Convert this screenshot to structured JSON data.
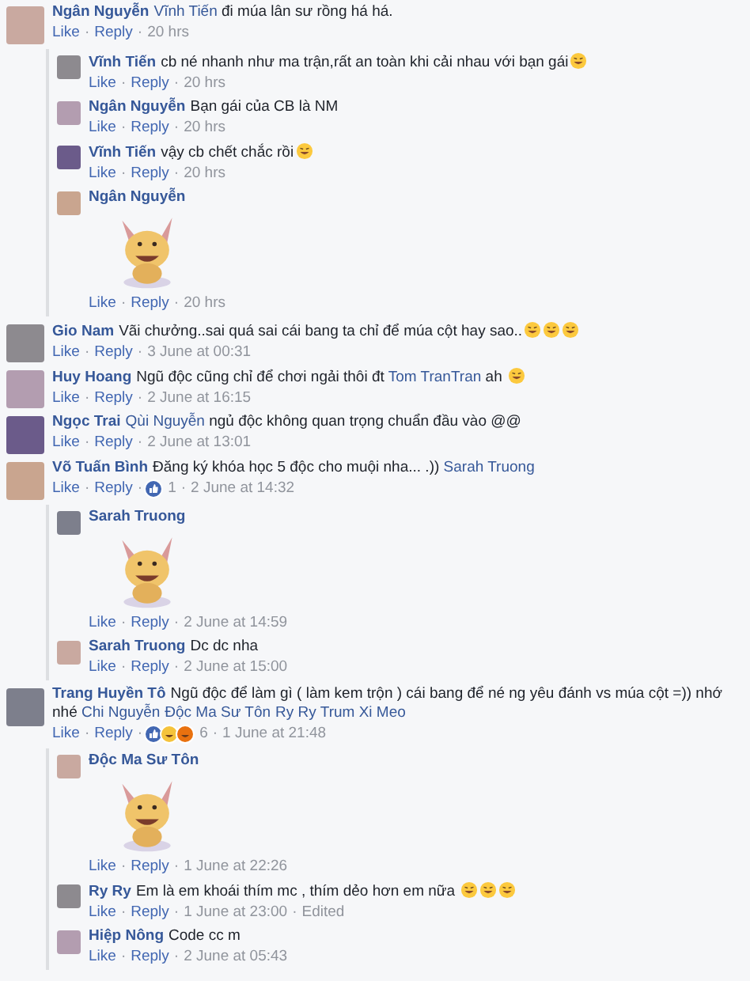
{
  "separator": "·",
  "comments": [
    {
      "author": "Ngân Nguyễn",
      "parts": [
        {
          "kind": "mention",
          "text": "Vĩnh Tiến"
        },
        {
          "kind": "text",
          "text": " đi múa lân sư rồng há há."
        }
      ],
      "like": "Like",
      "reply": "Reply",
      "time": "20 hrs",
      "replies": [
        {
          "author": "Vĩnh Tiến",
          "parts": [
            {
              "kind": "text",
              "text": "cb né nhanh như ma trận,rất an toàn khi cải nhau với bạn gái"
            },
            {
              "kind": "emoji"
            }
          ],
          "like": "Like",
          "reply": "Reply",
          "time": "20 hrs"
        },
        {
          "author": "Ngân Nguyễn",
          "parts": [
            {
              "kind": "text",
              "text": "Bạn gái của CB là NM"
            }
          ],
          "like": "Like",
          "reply": "Reply",
          "time": "20 hrs"
        },
        {
          "author": "Vĩnh Tiến",
          "parts": [
            {
              "kind": "text",
              "text": "vậy cb chết chắc rồi"
            },
            {
              "kind": "emoji"
            }
          ],
          "like": "Like",
          "reply": "Reply",
          "time": "20 hrs"
        },
        {
          "author": "Ngân Nguyễn",
          "sticker": true,
          "like": "Like",
          "reply": "Reply",
          "time": "20 hrs"
        }
      ]
    },
    {
      "author": "Gio Nam",
      "parts": [
        {
          "kind": "text",
          "text": "Vãi chưởng..sai quá sai cái bang ta chỉ để múa cột hay sao.."
        },
        {
          "kind": "emoji"
        },
        {
          "kind": "emoji"
        },
        {
          "kind": "emoji"
        }
      ],
      "like": "Like",
      "reply": "Reply",
      "time": "3 June at 00:31"
    },
    {
      "author": "Huy Hoang",
      "parts": [
        {
          "kind": "text",
          "text": "Ngũ độc cũng chỉ để chơi ngải thôi đt "
        },
        {
          "kind": "mention",
          "text": "Tom TranTran"
        },
        {
          "kind": "text",
          "text": " ah "
        },
        {
          "kind": "emoji"
        }
      ],
      "like": "Like",
      "reply": "Reply",
      "time": "2 June at 16:15"
    },
    {
      "author": "Ngọc Trai",
      "parts": [
        {
          "kind": "mention",
          "text": "Qùi Nguyễn"
        },
        {
          "kind": "text",
          "text": " ngủ độc không quan trọng chuẩn đầu vào @@"
        }
      ],
      "like": "Like",
      "reply": "Reply",
      "time": "2 June at 13:01"
    },
    {
      "author": "Võ Tuấn Bình",
      "parts": [
        {
          "kind": "text",
          "text": "Đăng ký khóa học 5 độc cho muội nha... .)) "
        },
        {
          "kind": "mention",
          "text": "Sarah Truong"
        }
      ],
      "like": "Like",
      "reply": "Reply",
      "reactions": {
        "items": [
          {
            "kind": "like"
          }
        ],
        "count": "1"
      },
      "time": "2 June at 14:32",
      "replies": [
        {
          "author": "Sarah Truong",
          "sticker": true,
          "like": "Like",
          "reply": "Reply",
          "time": "2 June at 14:59"
        },
        {
          "author": "Sarah Truong",
          "parts": [
            {
              "kind": "text",
              "text": "Dc dc nha"
            }
          ],
          "like": "Like",
          "reply": "Reply",
          "time": "2 June at 15:00"
        }
      ]
    },
    {
      "author": "Trang Huyền Tô",
      "parts": [
        {
          "kind": "text",
          "text": "Ngũ độc để làm gì ( làm kem trộn ) cái bang để né ng yêu đánh vs múa cột =)) nhớ nhé "
        },
        {
          "kind": "mention",
          "text": "Chi Nguyễn"
        },
        {
          "kind": "mention",
          "text": "Độc Ma Sư Tôn"
        },
        {
          "kind": "mention",
          "text": "Ry Ry Trum Xi Meo"
        }
      ],
      "like": "Like",
      "reply": "Reply",
      "reactions": {
        "items": [
          {
            "kind": "like"
          },
          {
            "kind": "haha"
          },
          {
            "kind": "angry"
          }
        ],
        "count": "6"
      },
      "time": "1 June at 21:48",
      "replies": [
        {
          "author": "Độc Ma Sư Tôn",
          "sticker": true,
          "like": "Like",
          "reply": "Reply",
          "time": "1 June at 22:26"
        },
        {
          "author": "Ry Ry",
          "parts": [
            {
              "kind": "text",
              "text": "Em là em khoái thím mc , thím dẻo hơn em nữa "
            },
            {
              "kind": "emoji"
            },
            {
              "kind": "emoji"
            },
            {
              "kind": "emoji"
            }
          ],
          "like": "Like",
          "reply": "Reply",
          "time": "1 June at 23:00",
          "edited": "Edited"
        },
        {
          "author": "Hiệp Nông",
          "parts": [
            {
              "kind": "text",
              "text": "Code cc m"
            }
          ],
          "like": "Like",
          "reply": "Reply",
          "time": "2 June at 05:43"
        }
      ]
    }
  ]
}
